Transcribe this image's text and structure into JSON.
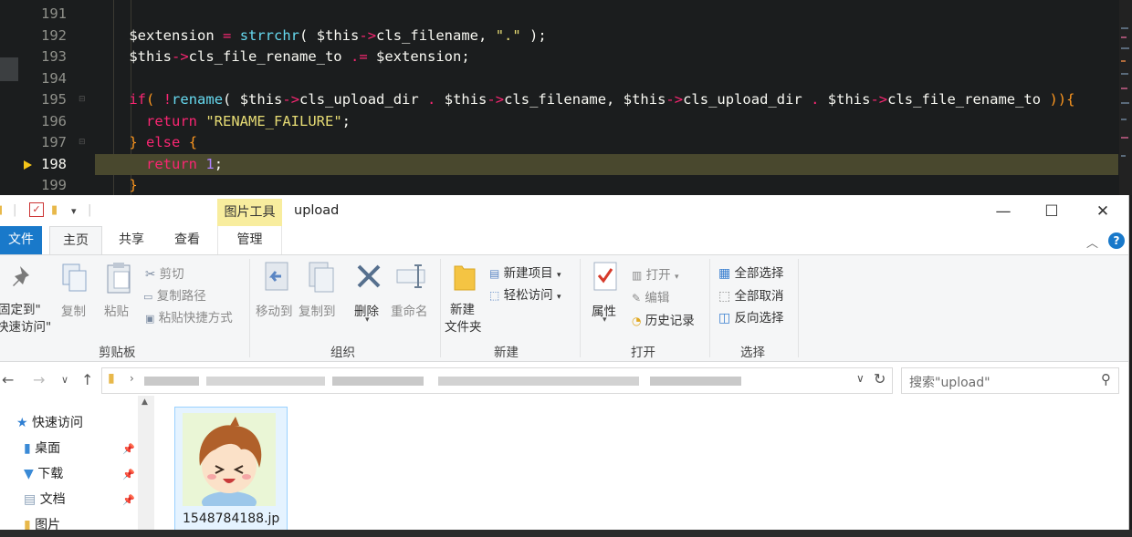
{
  "editor": {
    "lines": [
      {
        "num": "191",
        "current": false
      },
      {
        "num": "192",
        "current": false
      },
      {
        "num": "193",
        "current": false
      },
      {
        "num": "194",
        "current": false
      },
      {
        "num": "195",
        "current": false
      },
      {
        "num": "196",
        "current": false
      },
      {
        "num": "197",
        "current": false
      },
      {
        "num": "198",
        "current": true
      },
      {
        "num": "199",
        "current": false
      }
    ],
    "code": {
      "l192_var": "$extension",
      "l192_op": "=",
      "l192_fn": "strrchr",
      "l192_arg": "$this",
      "l192_arrow": "->",
      "l192_prop": "cls_filename,",
      "l192_str": "\".\"",
      "l192_end": ");",
      "l193_var": "$this",
      "l193_arrow": "->",
      "l193_prop": "cls_file_rename_to",
      "l193_op": ".=",
      "l193_rhs": "$extension;",
      "l195_kw": "if",
      "l195_open": "(",
      "l195_not": "!",
      "l195_fn": "rename",
      "l195_args_a": "$this",
      "l195_args_b": "cls_upload_dir",
      "l195_args_c": "$this",
      "l195_args_d": "cls_filename,",
      "l195_args_e": "$this",
      "l195_args_f": "cls_upload_dir",
      "l195_args_g": "$this",
      "l195_args_h": "cls_file_rename_to",
      "l195_close": ")){",
      "l196_kw": "return",
      "l196_str": "\"RENAME_FAILURE\"",
      "l196_end": ";",
      "l197_close": "}",
      "l197_kw": "else",
      "l197_open": "{",
      "l198_kw": "return",
      "l198_num": "1",
      "l198_end": ";",
      "l199_close": "}"
    }
  },
  "explorer": {
    "title": "upload",
    "context_tab": "图片工具",
    "tabs": {
      "file": "文件",
      "home": "主页",
      "share": "共享",
      "view": "查看",
      "manage": "管理"
    },
    "clipboard": {
      "pin": [
        "固定到\"",
        "快速访问\""
      ],
      "copy": "复制",
      "paste": "粘贴",
      "cut": "剪切",
      "copy_path": "复制路径",
      "paste_shortcut": "粘贴快捷方式",
      "label": "剪贴板"
    },
    "organize": {
      "move_to": "移动到",
      "copy_to": "复制到",
      "delete": "删除",
      "rename": "重命名",
      "label": "组织"
    },
    "new": {
      "new_folder": [
        "新建",
        "文件夹"
      ],
      "new_item": "新建项目",
      "easy_access": "轻松访问",
      "label": "新建"
    },
    "open": {
      "properties": "属性",
      "open": "打开",
      "edit": "编辑",
      "history": "历史记录",
      "label": "打开"
    },
    "select": {
      "select_all": "全部选择",
      "select_none": "全部取消",
      "invert": "反向选择",
      "label": "选择"
    },
    "search_placeholder": "搜索\"upload\"",
    "nav": {
      "quick_access": "快速访问",
      "items": [
        {
          "label": "桌面",
          "icon": "desktop-folder-icon"
        },
        {
          "label": "下载",
          "icon": "downloads-folder-icon"
        },
        {
          "label": "文档",
          "icon": "documents-folder-icon"
        },
        {
          "label": "图片",
          "icon": "pictures-folder-icon"
        }
      ]
    },
    "files": [
      {
        "name": "1548784188.jp"
      }
    ]
  },
  "colors": {
    "editor_bg": "#1b1d1e",
    "highlight_line": "#49482e",
    "ribbon_file_tab": "#1979ca",
    "context_tab": "#f8ed9e"
  }
}
